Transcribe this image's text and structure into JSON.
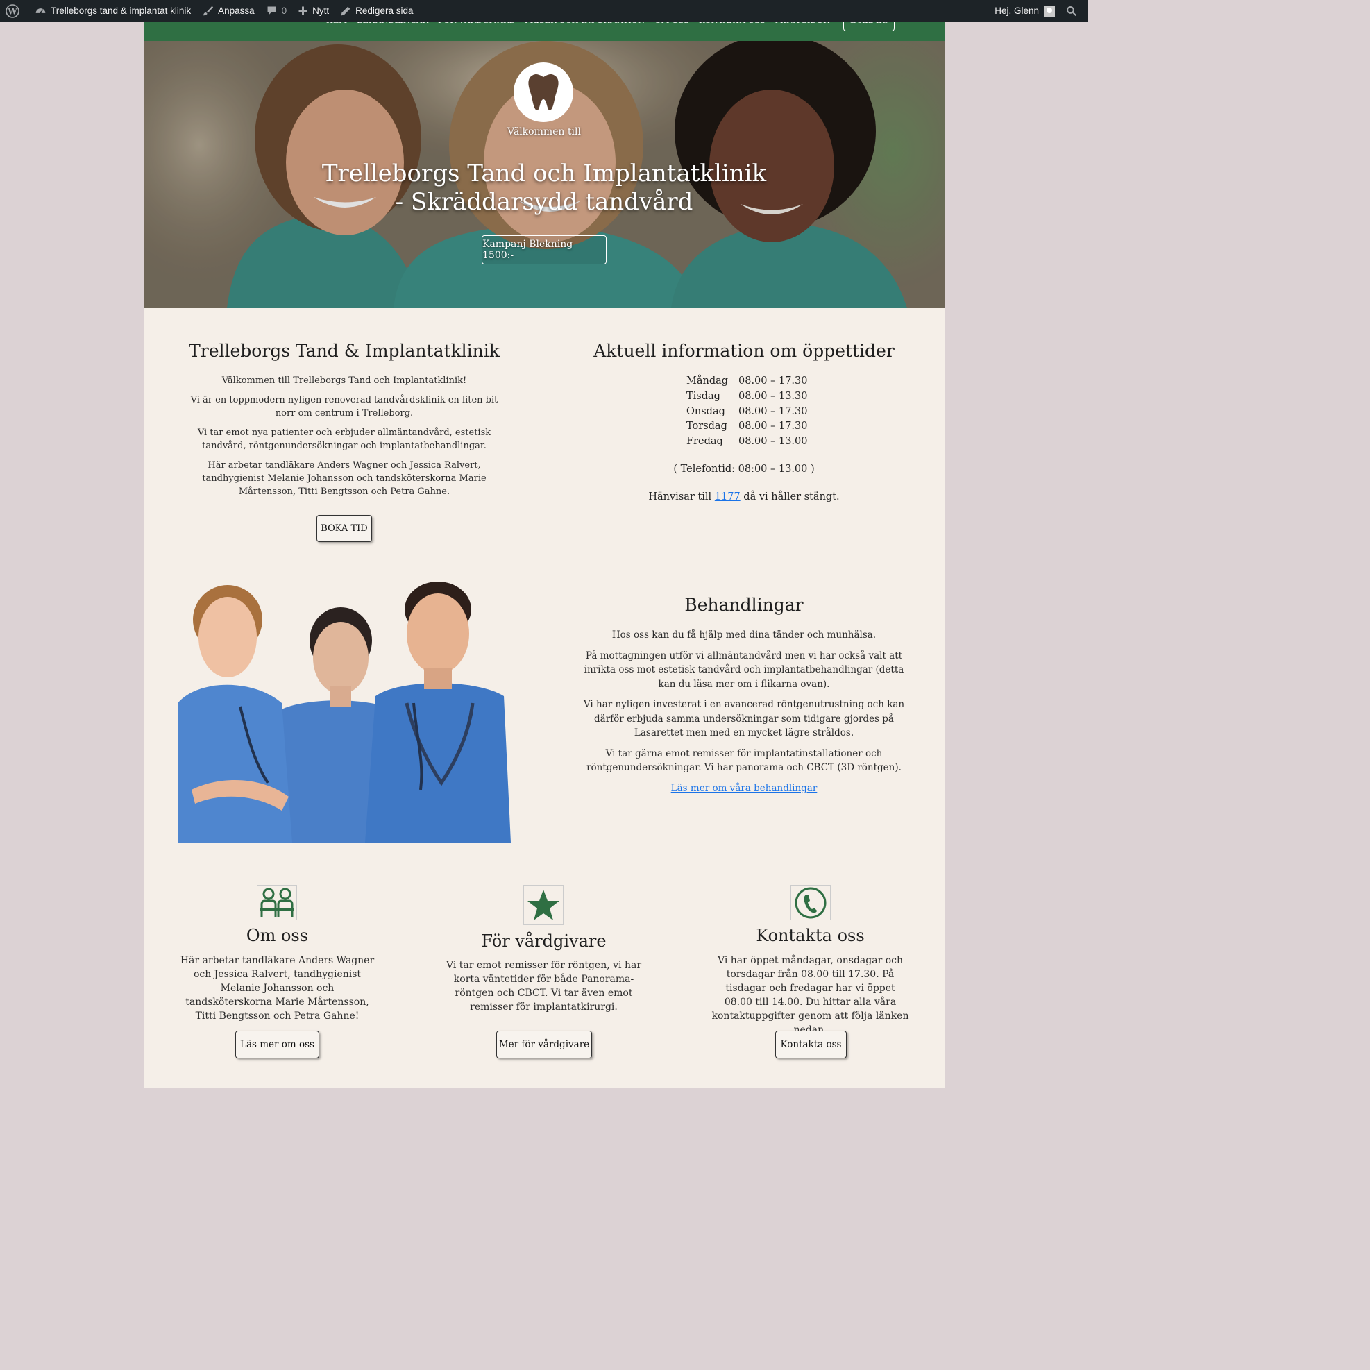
{
  "admin_bar": {
    "site_name": "Trelleborgs tand & implantat klinik",
    "customize": "Anpassa",
    "comments_count": "0",
    "new": "Nytt",
    "edit_page": "Redigera sida",
    "greeting": "Hej, Glenn"
  },
  "nav": {
    "site_title": "Trelleborgs Tandklinik",
    "links": [
      "Hem",
      "Behandlingar",
      "För vårdgivare",
      "Priser och information",
      "Om oss",
      "Kontakta oss",
      "Mina sidor"
    ],
    "cta": "Boka nu"
  },
  "hero": {
    "kicker": "Välkommen till",
    "title_line1": "Trelleborgs Tand och Implantatklinik",
    "title_line2": "- Skräddarsydd tandvård",
    "cta": "Kampanj Blekning 1500:-"
  },
  "intro": {
    "title": "Trelleborgs Tand & Implantatklinik",
    "paragraphs": [
      "Välkommen till Trelleborgs Tand och Implantatklinik!",
      "Vi är en toppmodern nyligen renoverad tandvårdsklinik en liten bit norr om centrum i Trelleborg.",
      "Vi tar emot nya patienter och erbjuder allmäntandvård, estetisk tandvård, röntgenundersökningar och implantatbehandlingar.",
      "Här arbetar tandläkare Anders Wagner och Jessica Ralvert, tandhygienist Melanie Johansson och tandsköterskorna Marie Mårtensson, Titti Bengtsson och Petra Gahne."
    ],
    "button": "BOKA TID"
  },
  "hours": {
    "title": "Aktuell information om öppettider",
    "rows": [
      {
        "day": "Måndag",
        "time": "08.00 – 17.30"
      },
      {
        "day": "Tisdag",
        "time": "08.00 – 13.30"
      },
      {
        "day": "Onsdag",
        "time": "08.00 – 17.30"
      },
      {
        "day": "Torsdag",
        "time": "08.00 – 17.30"
      },
      {
        "day": "Fredag",
        "time": "08.00 – 13.00"
      }
    ],
    "phone_time": "( Telefontid: 08:00 – 13.00 )",
    "refer_prefix": "Hänvisar till ",
    "refer_link": "1177",
    "refer_suffix": " då vi håller stängt."
  },
  "treatments": {
    "title": "Behandlingar",
    "paragraphs": [
      "Hos oss kan du få hjälp med dina tänder och munhälsa.",
      "På mottagningen utför vi allmäntandvård men vi har också valt att inrikta oss mot estetisk tandvård och implantatbehandlingar (detta kan du läsa mer om i flikarna ovan).",
      "Vi har nyligen investerat i en avancerad röntgenutrustning och kan därför erbjuda samma undersökningar som tidigare gjordes på Lasarettet men med en mycket lägre stråldos.",
      "Vi tar gärna emot remisser för implantatinstallationer och röntgenundersökningar. Vi har panorama och CBCT (3D röntgen)."
    ],
    "link": "Läs mer om våra behandlingar"
  },
  "cards": [
    {
      "icon": "people-icon",
      "title": "Om oss",
      "text": "Här arbetar tandläkare Anders Wagner och Jessica Ralvert, tandhygienist Melanie Johansson och tandsköterskorna Marie Mårtensson, Titti Bengtsson och Petra Gahne!",
      "button": "Läs mer om oss"
    },
    {
      "icon": "star-icon",
      "title": "För vårdgivare",
      "text": "Vi tar emot remisser för röntgen, vi har korta väntetider för både Panorama-röntgen och CBCT. Vi tar även emot remisser för implantatkirurgi.",
      "button": "Mer för vårdgivare"
    },
    {
      "icon": "phone-icon",
      "title": "Kontakta oss",
      "text": "Vi har öppet måndagar, onsdagar och torsdagar från 08.00 till 17.30. På tisdagar och fredagar har vi öppet 08.00 till 14.00. Du hittar alla våra kontaktuppgifter genom att följa länken nedan.",
      "button": "Kontakta oss"
    }
  ],
  "colors": {
    "brand_green": "#2f6f43",
    "admin_bar": "#1d2327",
    "page_bg": "#f5efe8",
    "link_blue": "#1a73e8"
  }
}
